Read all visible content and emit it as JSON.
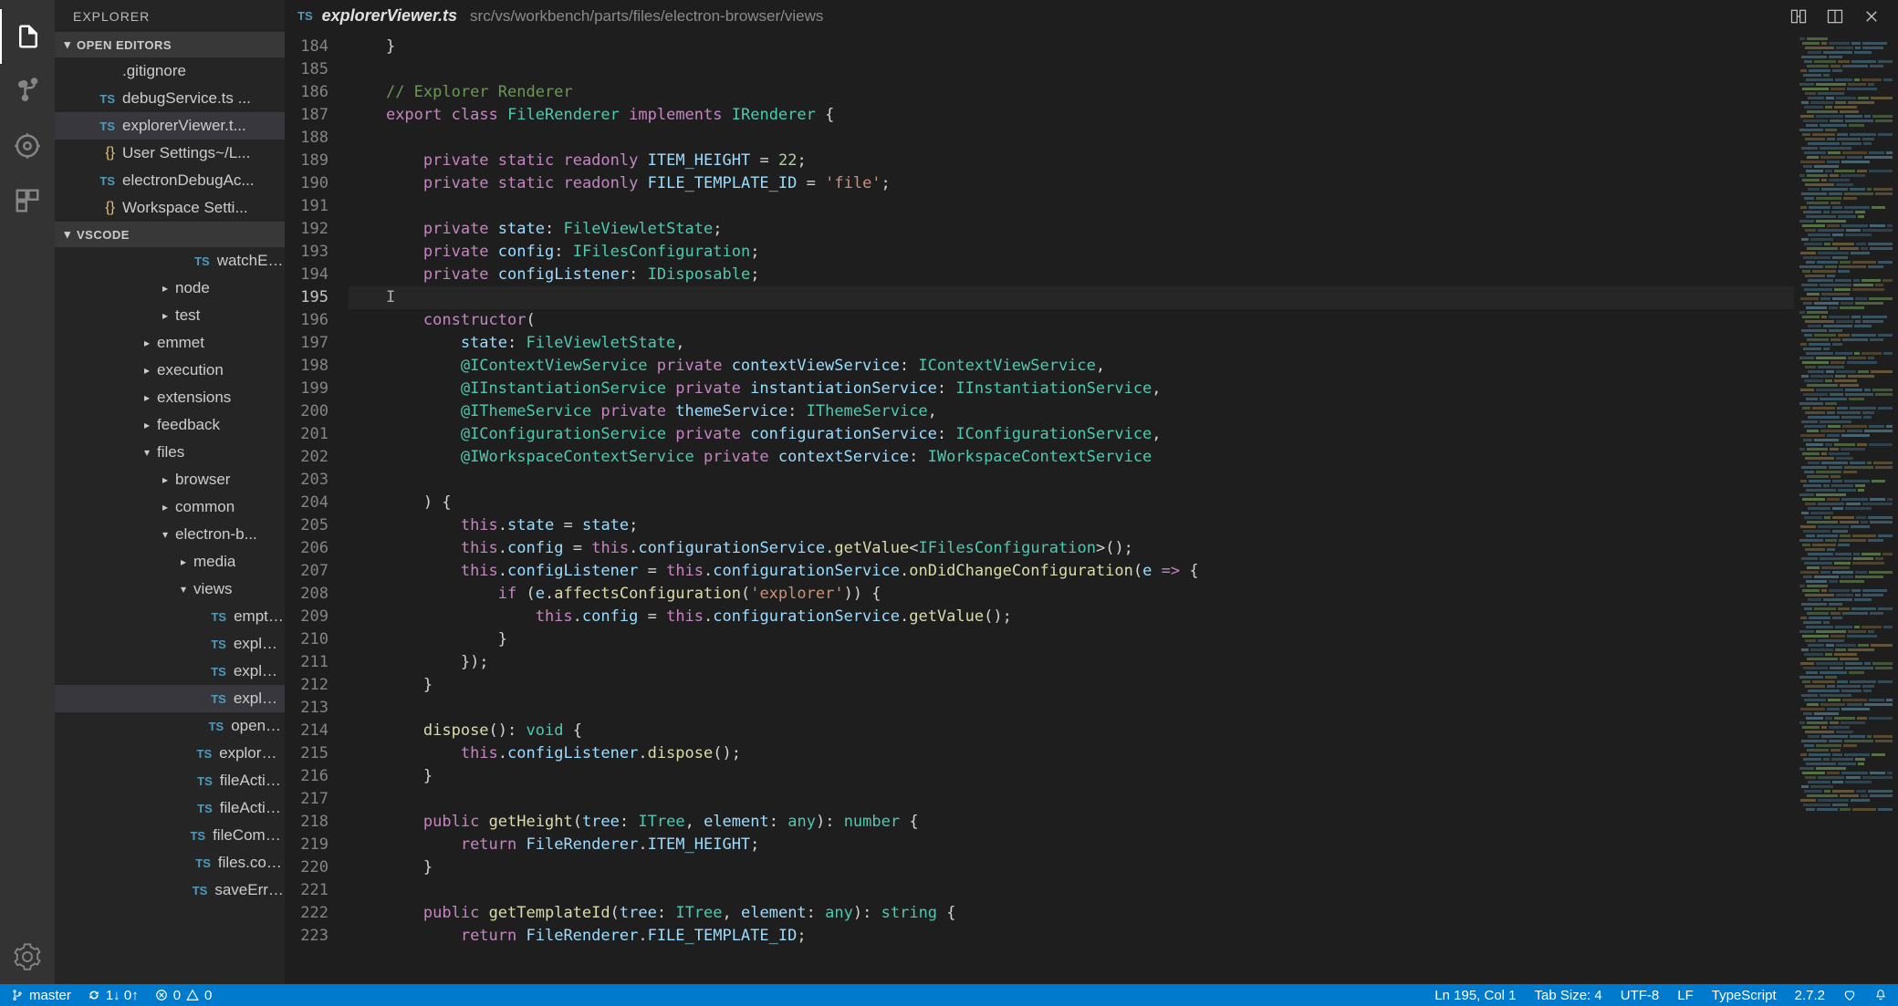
{
  "sidebar": {
    "title": "EXPLORER",
    "sections": {
      "openEditors": "OPEN EDITORS",
      "vscode": "VSCODE"
    }
  },
  "openEditors": [
    {
      "icon": "",
      "label": ".gitignore",
      "active": false,
      "iconClass": "blank"
    },
    {
      "icon": "TS",
      "label": "debugService.ts ...",
      "active": false,
      "iconClass": "ts"
    },
    {
      "icon": "TS",
      "label": "explorerViewer.t...",
      "active": true,
      "iconClass": "ts"
    },
    {
      "icon": "{}",
      "label": "User Settings",
      "suffix": "~/L...",
      "active": false,
      "iconClass": "bracket"
    },
    {
      "icon": "TS",
      "label": "electronDebugAc...",
      "active": false,
      "iconClass": "ts"
    },
    {
      "icon": "{}",
      "label": "Workspace Setti...",
      "active": false,
      "iconClass": "bracket"
    }
  ],
  "tree": [
    {
      "indent": 1,
      "icon": "TS",
      "label": "watchEx...",
      "type": "file",
      "iconClass": "ts"
    },
    {
      "indent": 0,
      "chev": "▸",
      "label": "node",
      "type": "folder"
    },
    {
      "indent": 0,
      "chev": "▸",
      "label": "test",
      "type": "folder"
    },
    {
      "indent": -1,
      "chev": "▸",
      "label": "emmet",
      "type": "folder"
    },
    {
      "indent": -1,
      "chev": "▸",
      "label": "execution",
      "type": "folder"
    },
    {
      "indent": -1,
      "chev": "▸",
      "label": "extensions",
      "type": "folder"
    },
    {
      "indent": -1,
      "chev": "▸",
      "label": "feedback",
      "type": "folder"
    },
    {
      "indent": -1,
      "chev": "▾",
      "label": "files",
      "type": "folder"
    },
    {
      "indent": 0,
      "chev": "▸",
      "label": "browser",
      "type": "folder"
    },
    {
      "indent": 0,
      "chev": "▸",
      "label": "common",
      "type": "folder"
    },
    {
      "indent": 0,
      "chev": "▾",
      "label": "electron-b...",
      "type": "folder"
    },
    {
      "indent": 1,
      "chev": "▸",
      "label": "media",
      "type": "folder"
    },
    {
      "indent": 1,
      "chev": "▾",
      "label": "views",
      "type": "folder"
    },
    {
      "indent": 2,
      "icon": "TS",
      "label": "empty...",
      "type": "file",
      "iconClass": "ts"
    },
    {
      "indent": 2,
      "icon": "TS",
      "label": "explor...",
      "type": "file",
      "iconClass": "ts"
    },
    {
      "indent": 2,
      "icon": "TS",
      "label": "explor...",
      "type": "file",
      "iconClass": "ts"
    },
    {
      "indent": 2,
      "icon": "TS",
      "label": "explor...",
      "type": "file",
      "iconClass": "ts",
      "active": true
    },
    {
      "indent": 2,
      "icon": "TS",
      "label": "openE...",
      "type": "file",
      "iconClass": "ts"
    },
    {
      "indent": 1,
      "icon": "TS",
      "label": "explorer...",
      "type": "file",
      "iconClass": "ts"
    },
    {
      "indent": 1,
      "icon": "TS",
      "label": "fileActio...",
      "type": "file",
      "iconClass": "ts"
    },
    {
      "indent": 1,
      "icon": "TS",
      "label": "fileActio...",
      "type": "file",
      "iconClass": "ts"
    },
    {
      "indent": 1,
      "icon": "TS",
      "label": "fileComm...",
      "type": "file",
      "iconClass": "ts"
    },
    {
      "indent": 1,
      "icon": "TS",
      "label": "files.con...",
      "type": "file",
      "iconClass": "ts"
    },
    {
      "indent": 1,
      "icon": "TS",
      "label": "saveErro...",
      "type": "file",
      "iconClass": "ts"
    }
  ],
  "tab": {
    "icon": "TS",
    "filename": "explorerViewer.ts",
    "path": "src/vs/workbench/parts/files/electron-browser/views"
  },
  "lineNumbers": {
    "start": 184,
    "end": 223,
    "current": 195
  },
  "code": [
    {
      "n": 184,
      "html": "    <span class='op'>}</span>"
    },
    {
      "n": 185,
      "html": ""
    },
    {
      "n": 186,
      "html": "    <span class='cm'>// Explorer Renderer</span>"
    },
    {
      "n": 187,
      "html": "    <span class='kw'>export</span> <span class='kw'>class</span> <span class='type'>FileRenderer</span> <span class='kw'>implements</span> <span class='type'>IRenderer</span> <span class='op'>{</span>"
    },
    {
      "n": 188,
      "html": ""
    },
    {
      "n": 189,
      "html": "        <span class='kw'>private</span> <span class='kw'>static</span> <span class='kw'>readonly</span> <span class='id'>ITEM_HEIGHT</span> <span class='op'>=</span> <span class='num'>22</span><span class='op'>;</span>"
    },
    {
      "n": 190,
      "html": "        <span class='kw'>private</span> <span class='kw'>static</span> <span class='kw'>readonly</span> <span class='id'>FILE_TEMPLATE_ID</span> <span class='op'>=</span> <span class='str'>'file'</span><span class='op'>;</span>"
    },
    {
      "n": 191,
      "html": ""
    },
    {
      "n": 192,
      "html": "        <span class='kw'>private</span> <span class='id'>state</span><span class='op'>:</span> <span class='type'>FileViewletState</span><span class='op'>;</span>"
    },
    {
      "n": 193,
      "html": "        <span class='kw'>private</span> <span class='id'>config</span><span class='op'>:</span> <span class='type'>IFilesConfiguration</span><span class='op'>;</span>"
    },
    {
      "n": 194,
      "html": "        <span class='kw'>private</span> <span class='id'>configListener</span><span class='op'>:</span> <span class='type'>IDisposable</span><span class='op'>;</span>"
    },
    {
      "n": 195,
      "html": "    <span class='cursor-caret'>I</span>",
      "current": true
    },
    {
      "n": 196,
      "html": "        <span class='kw'>constructor</span><span class='op'>(</span>"
    },
    {
      "n": 197,
      "html": "            <span class='id'>state</span><span class='op'>:</span> <span class='type'>FileViewletState</span><span class='op'>,</span>"
    },
    {
      "n": 198,
      "html": "            <span class='dec'>@IContextViewService</span> <span class='kw'>private</span> <span class='id'>contextViewService</span><span class='op'>:</span> <span class='type'>IContextViewService</span><span class='op'>,</span>"
    },
    {
      "n": 199,
      "html": "            <span class='dec'>@IInstantiationService</span> <span class='kw'>private</span> <span class='id'>instantiationService</span><span class='op'>:</span> <span class='type'>IInstantiationService</span><span class='op'>,</span>"
    },
    {
      "n": 200,
      "html": "            <span class='dec'>@IThemeService</span> <span class='kw'>private</span> <span class='id'>themeService</span><span class='op'>:</span> <span class='type'>IThemeService</span><span class='op'>,</span>"
    },
    {
      "n": 201,
      "html": "            <span class='dec'>@IConfigurationService</span> <span class='kw'>private</span> <span class='id'>configurationService</span><span class='op'>:</span> <span class='type'>IConfigurationService</span><span class='op'>,</span>"
    },
    {
      "n": 202,
      "html": "            <span class='dec'>@IWorkspaceContextService</span> <span class='kw'>private</span> <span class='id'>contextService</span><span class='op'>:</span> <span class='type'>IWorkspaceContextService</span>"
    },
    {
      "n": 203,
      "html": ""
    },
    {
      "n": 204,
      "html": "        <span class='op'>) {</span>"
    },
    {
      "n": 205,
      "html": "            <span class='kw'>this</span><span class='op'>.</span><span class='id'>state</span> <span class='op'>=</span> <span class='id'>state</span><span class='op'>;</span>"
    },
    {
      "n": 206,
      "html": "            <span class='kw'>this</span><span class='op'>.</span><span class='id'>config</span> <span class='op'>=</span> <span class='kw'>this</span><span class='op'>.</span><span class='id'>configurationService</span><span class='op'>.</span><span class='fn'>getValue</span><span class='op'>&lt;</span><span class='type'>IFilesConfiguration</span><span class='op'>&gt;();</span>"
    },
    {
      "n": 207,
      "html": "            <span class='kw'>this</span><span class='op'>.</span><span class='id'>configListener</span> <span class='op'>=</span> <span class='kw'>this</span><span class='op'>.</span><span class='id'>configurationService</span><span class='op'>.</span><span class='fn'>onDidChangeConfiguration</span><span class='op'>(</span><span class='id'>e</span> <span class='kw'>=&gt;</span> <span class='op'>{</span>"
    },
    {
      "n": 208,
      "html": "                <span class='kw'>if</span> <span class='op'>(</span><span class='id'>e</span><span class='op'>.</span><span class='fn'>affectsConfiguration</span><span class='op'>(</span><span class='str'>'explorer'</span><span class='op'>)) {</span>"
    },
    {
      "n": 209,
      "html": "                    <span class='kw'>this</span><span class='op'>.</span><span class='id'>config</span> <span class='op'>=</span> <span class='kw'>this</span><span class='op'>.</span><span class='id'>configurationService</span><span class='op'>.</span><span class='fn'>getValue</span><span class='op'>();</span>"
    },
    {
      "n": 210,
      "html": "                <span class='op'>}</span>"
    },
    {
      "n": 211,
      "html": "            <span class='op'>});</span>"
    },
    {
      "n": 212,
      "html": "        <span class='op'>}</span>"
    },
    {
      "n": 213,
      "html": ""
    },
    {
      "n": 214,
      "html": "        <span class='fn'>dispose</span><span class='op'>():</span> <span class='type'>void</span> <span class='op'>{</span>"
    },
    {
      "n": 215,
      "html": "            <span class='kw'>this</span><span class='op'>.</span><span class='id'>configListener</span><span class='op'>.</span><span class='fn'>dispose</span><span class='op'>();</span>"
    },
    {
      "n": 216,
      "html": "        <span class='op'>}</span>"
    },
    {
      "n": 217,
      "html": ""
    },
    {
      "n": 218,
      "html": "        <span class='kw'>public</span> <span class='fn'>getHeight</span><span class='op'>(</span><span class='id'>tree</span><span class='op'>:</span> <span class='type'>ITree</span><span class='op'>,</span> <span class='id'>element</span><span class='op'>:</span> <span class='type'>any</span><span class='op'>):</span> <span class='type'>number</span> <span class='op'>{</span>"
    },
    {
      "n": 219,
      "html": "            <span class='kw'>return</span> <span class='id'>FileRenderer</span><span class='op'>.</span><span class='id'>ITEM_HEIGHT</span><span class='op'>;</span>"
    },
    {
      "n": 220,
      "html": "        <span class='op'>}</span>"
    },
    {
      "n": 221,
      "html": ""
    },
    {
      "n": 222,
      "html": "        <span class='kw'>public</span> <span class='fn'>getTemplateId</span><span class='op'>(</span><span class='id'>tree</span><span class='op'>:</span> <span class='type'>ITree</span><span class='op'>,</span> <span class='id'>element</span><span class='op'>:</span> <span class='type'>any</span><span class='op'>):</span> <span class='type'>string</span> <span class='op'>{</span>"
    },
    {
      "n": 223,
      "html": "            <span class='kw'>return</span> <span class='id'>FileRenderer</span><span class='op'>.</span><span class='id'>FILE_TEMPLATE_ID</span><span class='op'>;</span>"
    }
  ],
  "status": {
    "branch": "master",
    "sync": "1↓ 0↑",
    "errors": "0",
    "warnings": "0",
    "lineCol": "Ln 195, Col 1",
    "tabSize": "Tab Size: 4",
    "encoding": "UTF-8",
    "eol": "LF",
    "lang": "TypeScript",
    "tsVersion": "2.7.2"
  }
}
